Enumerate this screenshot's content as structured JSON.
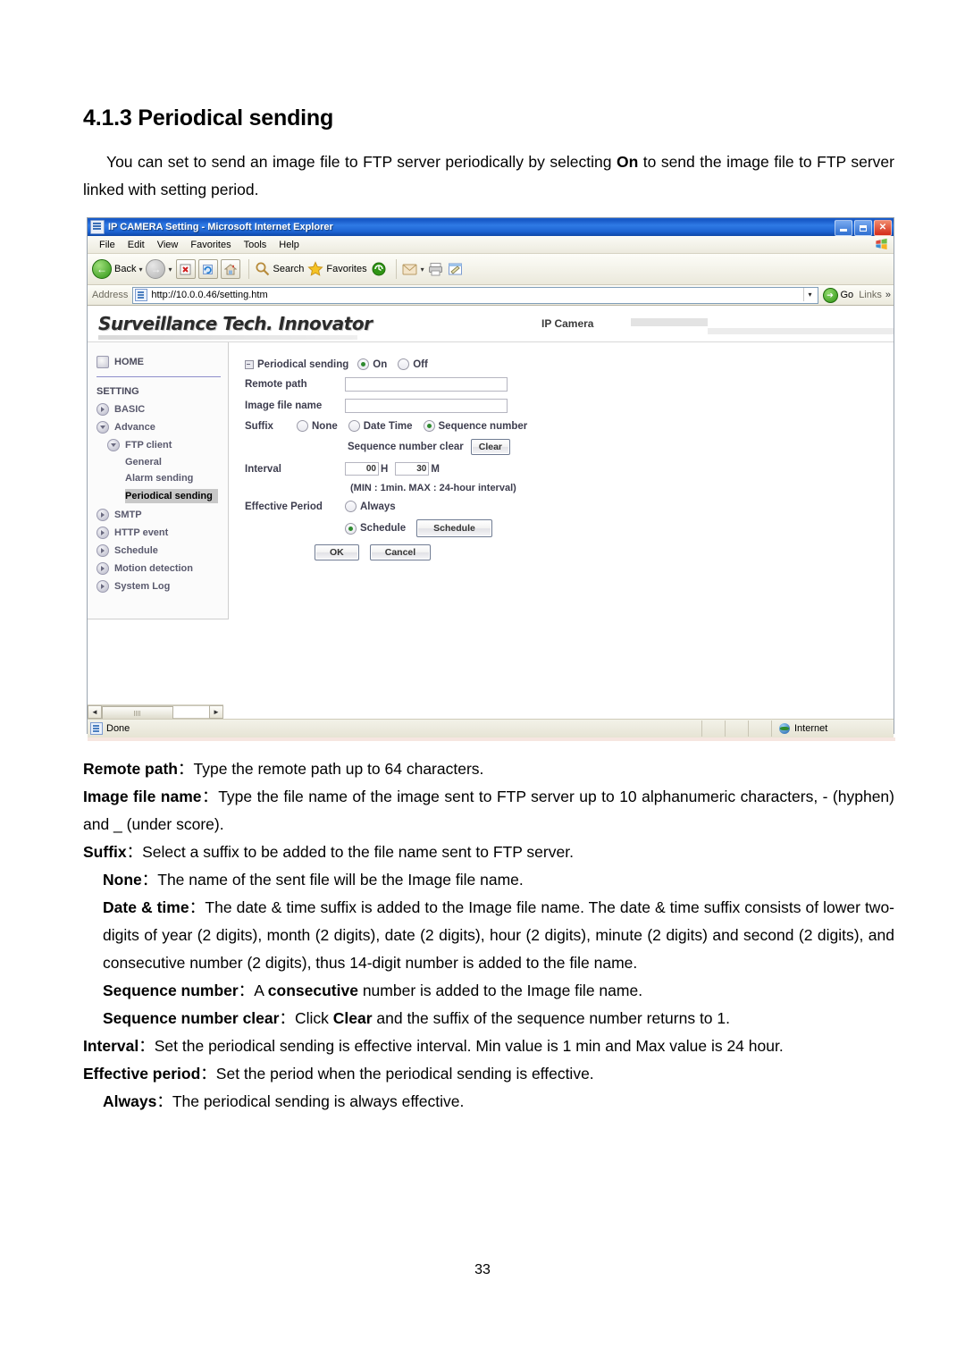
{
  "document": {
    "heading": "4.1.3 Periodical sending",
    "intro_parts": {
      "a": "You can set to send an image file to FTP server periodically by selecting ",
      "b": "On",
      "c": " to send the image file to FTP server linked with setting period."
    },
    "definitions": [
      {
        "term": "Remote path",
        "colon": "：",
        "text": "Type the remote path up to 64 characters."
      },
      {
        "term": "Image file name",
        "colon": "：",
        "text": "Type the file name of the image sent to FTP server up to 10 alphanumeric characters, - (hyphen) and _ (under score)."
      },
      {
        "term": "Suffix",
        "colon": "：",
        "text": "Select a suffix to be added to the file name sent to FTP server."
      },
      {
        "term": "None",
        "colon": "：",
        "text": "The name of the sent file will be the Image file name."
      },
      {
        "term": "Date & time",
        "colon": "：",
        "text": "The date & time suffix is added to the Image file name. The date & time suffix consists of lower two-digits of year (2 digits), month (2 digits), date (2 digits), hour (2 digits), minute (2 digits) and second (2 digits), and consecutive number (2 digits), thus 14-digit number is added to the file name."
      },
      {
        "term": "Sequence number",
        "colon": "：",
        "text_a": "A ",
        "text_b": "consecutive",
        "text_c": " number is added to the Image file name."
      },
      {
        "term": "Sequence number clear",
        "colon": "：",
        "text_a": "Click ",
        "text_b": "Clear",
        "text_c": " and the suffix of the sequence number returns to 1."
      },
      {
        "term": "Interval",
        "colon": "：",
        "text": "Set the periodical sending is effective interval. Min value is 1 min and Max value is 24 hour."
      },
      {
        "term": "Effective period",
        "colon": "：",
        "text": "Set the period when the periodical sending is effective."
      },
      {
        "term": "Always",
        "colon": "：",
        "text": "The periodical sending is always effective."
      }
    ],
    "page_number": "33"
  },
  "browser": {
    "title": "IP CAMERA Setting - Microsoft Internet Explorer",
    "window_controls": {
      "minimize": "_",
      "maximize": "□",
      "close": "✕"
    },
    "menus": [
      "File",
      "Edit",
      "View",
      "Favorites",
      "Tools",
      "Help"
    ],
    "toolbar": {
      "back": "Back",
      "forward": "",
      "stop": "✖",
      "refresh": "⟳",
      "home": "⌂",
      "search": "Search",
      "favorites": "Favorites",
      "history": "",
      "mail": "",
      "print": "",
      "edit": ""
    },
    "address": {
      "label": "Address",
      "url": "http://10.0.0.46/setting.htm",
      "go": "Go",
      "links": "Links",
      "more": "»"
    },
    "status": {
      "text": "Done",
      "zone": "Internet"
    }
  },
  "webpage": {
    "logo": "Surveillance Tech. Innovator",
    "product": "IP Camera",
    "sidebar": {
      "home": "HOME",
      "section": "SETTING",
      "items": [
        {
          "label": "BASIC",
          "level": 1
        },
        {
          "label": "Advance",
          "level": 1
        },
        {
          "label": "FTP client",
          "level": 2
        },
        {
          "label": "General",
          "level": 3
        },
        {
          "label": "Alarm sending",
          "level": 3
        },
        {
          "label": "Periodical sending",
          "level": 3,
          "active": true
        },
        {
          "label": "SMTP",
          "level": 1
        },
        {
          "label": "HTTP event",
          "level": 1
        },
        {
          "label": "Schedule",
          "level": 1
        },
        {
          "label": "Motion detection",
          "level": 1
        },
        {
          "label": "System Log",
          "level": 1
        }
      ]
    },
    "form": {
      "title": "Periodical sending",
      "on_label": "On",
      "off_label": "Off",
      "on_selected": true,
      "remote_path_label": "Remote path",
      "remote_path_value": "",
      "image_file_name_label": "Image file name",
      "image_file_name_value": "",
      "suffix_label": "Suffix",
      "suffix_options": [
        "None",
        "Date Time",
        "Sequence number"
      ],
      "suffix_selected": "Sequence number",
      "sequence_clear_label": "Sequence number clear",
      "clear_button": "Clear",
      "interval_label": "Interval",
      "interval_hours": "00",
      "interval_hours_unit": "H",
      "interval_minutes": "30",
      "interval_minutes_unit": "M",
      "interval_hint": "(MIN : 1min. MAX : 24-hour interval)",
      "effective_period_label": "Effective Period",
      "always_label": "Always",
      "schedule_label": "Schedule",
      "schedule_button": "Schedule",
      "effective_selected": "Schedule",
      "ok_button": "OK",
      "cancel_button": "Cancel"
    }
  },
  "colors": {
    "titlebar_blue": "#1d64d2",
    "accent_green": "#2f8b2f",
    "sidebar_text": "#5a5a6e",
    "active_highlight": "#c8c8c8"
  }
}
